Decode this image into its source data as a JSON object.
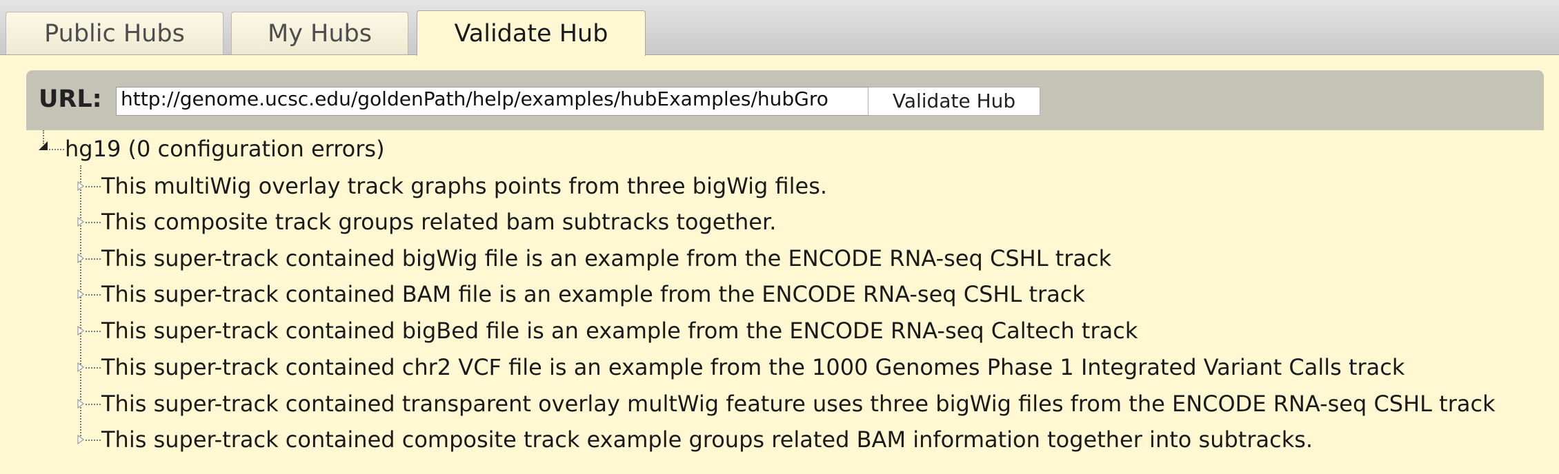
{
  "tabs": [
    {
      "label": "Public Hubs"
    },
    {
      "label": "My Hubs"
    },
    {
      "label": "Validate Hub"
    }
  ],
  "url_bar": {
    "label": "URL:",
    "value": "http://genome.ucsc.edu/goldenPath/help/examples/hubExamples/hubGro",
    "button_label": "Validate Hub"
  },
  "tree": {
    "root": {
      "label": "hg19 (0 configuration errors)",
      "expanded": true
    },
    "children": [
      {
        "label": "This multiWig overlay track graphs points from three bigWig files."
      },
      {
        "label": "This composite track groups related bam subtracks together."
      },
      {
        "label": "This super-track contained bigWig file is an example from the ENCODE RNA-seq CSHL track"
      },
      {
        "label": "This super-track contained BAM file is an example from the ENCODE RNA-seq CSHL track"
      },
      {
        "label": "This super-track contained bigBed file is an example from the ENCODE RNA-seq Caltech track"
      },
      {
        "label": "This super-track contained chr2 VCF file is an example from the 1000 Genomes Phase 1 Integrated Variant Calls track"
      },
      {
        "label": "This super-track contained transparent overlay multWig feature uses three bigWig files from the ENCODE RNA-seq CSHL track"
      },
      {
        "label": "This super-track contained composite track example groups related BAM information together into subtracks."
      }
    ]
  },
  "colors": {
    "page_background": "#fff8d2",
    "url_bar_background": "#c4c3b5",
    "tab_strip_background": "#d2d2d2"
  }
}
